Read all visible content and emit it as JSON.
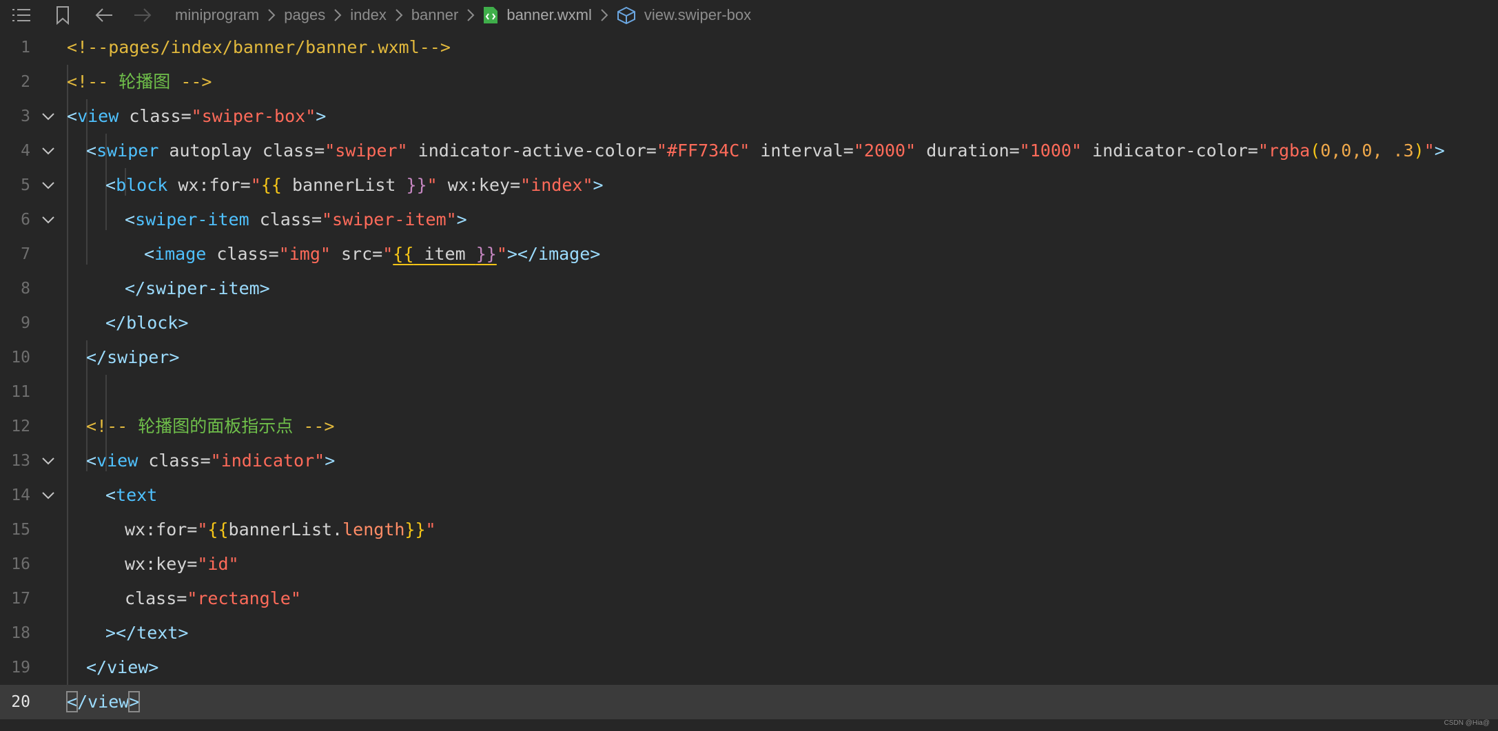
{
  "breadcrumb": {
    "items": [
      "miniprogram",
      "pages",
      "index",
      "banner"
    ],
    "file": "banner.wxml",
    "symbol": "view.swiper-box"
  },
  "icons": {
    "outline": "list-icon",
    "bookmark": "bookmark-icon",
    "back": "arrow-left-icon",
    "forward": "arrow-right-icon",
    "file": "wxml-file-icon",
    "symbol": "cube-icon"
  },
  "editor": {
    "line_numbers": [
      "1",
      "2",
      "3",
      "4",
      "5",
      "6",
      "7",
      "8",
      "9",
      "10",
      "11",
      "12",
      "13",
      "14",
      "15",
      "16",
      "17",
      "18",
      "19",
      "20"
    ],
    "current_line": "20",
    "code": {
      "l1": "<!--pages/index/banner/banner.wxml-->",
      "l2_open": "<!--",
      "l2_text": " 轮播图 ",
      "l2_close": "-->",
      "l3_open": "<",
      "l3_tag": "view",
      "l3_attr": " class=",
      "l3_val": "\"swiper-box\"",
      "l3_close": ">",
      "l4_open": "<",
      "l4_tag": "swiper",
      "l4_a1": " autoplay class=",
      "l4_v1": "\"swiper\"",
      "l4_a2": " indicator-active-color=",
      "l4_v2": "\"#FF734C\"",
      "l4_a3": " interval=",
      "l4_v3": "\"2000\"",
      "l4_a4": " duration=",
      "l4_v4": "\"1000\"",
      "l4_a5": " indicator-color=",
      "l4_q1": "\"",
      "l4_fn": "rgba",
      "l4_p1": "(",
      "l4_args": "0,0,0, .3",
      "l4_p2": ")",
      "l4_q2": "\"",
      "l4_close": ">",
      "l5_open": "<",
      "l5_tag": "block",
      "l5_a1": " wx:for=",
      "l5_q1": "\"",
      "l5_b1": "{{",
      "l5_expr": " bannerList ",
      "l5_b2": "}}",
      "l5_q2": "\"",
      "l5_a2": " wx:key=",
      "l5_v2": "\"index\"",
      "l5_close": ">",
      "l6_open": "<",
      "l6_tag": "swiper-item",
      "l6_attr": " class=",
      "l6_val": "\"swiper-item\"",
      "l6_close": ">",
      "l7_open": "<",
      "l7_tag": "image",
      "l7_a1": " class=",
      "l7_v1": "\"img\"",
      "l7_a2": " src=",
      "l7_q1": "\"",
      "l7_b1": "{{",
      "l7_expr": " item ",
      "l7_b2": "}}",
      "l7_q2": "\"",
      "l7_close": "></image>",
      "l8": "</swiper-item>",
      "l9": "</block>",
      "l10": "</swiper>",
      "l12_open": "<!--",
      "l12_text": " 轮播图的面板指示点 ",
      "l12_close": "-->",
      "l13_open": "<",
      "l13_tag": "view",
      "l13_attr": " class=",
      "l13_val": "\"indicator\"",
      "l13_close": ">",
      "l14_open": "<",
      "l14_tag": "text",
      "l15_a": "wx:for=",
      "l15_q1": "\"",
      "l15_b1": "{{",
      "l15_expr": "bannerList.",
      "l15_prop": "length",
      "l15_b2": "}}",
      "l15_q2": "\"",
      "l16_a": "wx:key=",
      "l16_v": "\"id\"",
      "l17_a": "class=",
      "l17_v": "\"rectangle\"",
      "l18": "></text>",
      "l19": "</view>",
      "l20_a": "<",
      "l20_b": "/view",
      "l20_c": ">"
    }
  },
  "watermark": "CSDN @Hia@"
}
